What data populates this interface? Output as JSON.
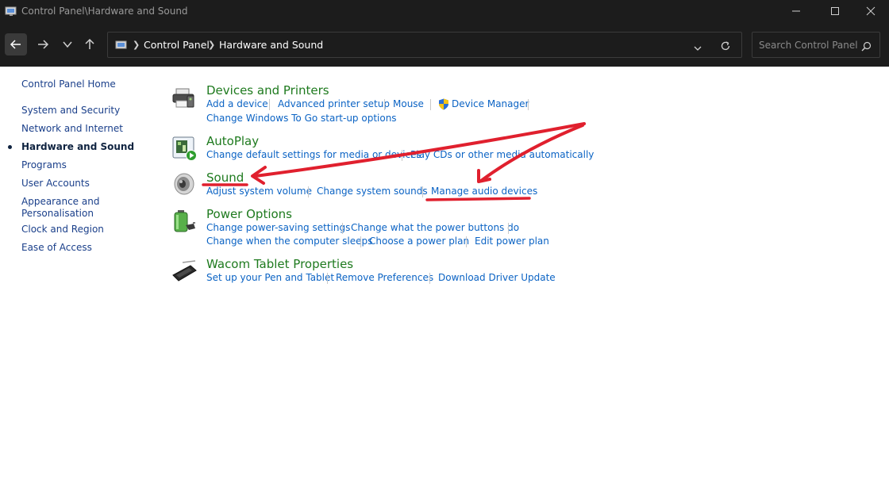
{
  "window": {
    "title": "Control Panel\\Hardware and Sound"
  },
  "address_bar": {
    "crumbs": [
      "Control Panel",
      "Hardware and Sound"
    ],
    "search_placeholder": "Search Control Panel"
  },
  "sidebar": {
    "items": [
      {
        "label": "Control Panel Home"
      },
      {
        "label": "System and Security"
      },
      {
        "label": "Network and Internet"
      },
      {
        "label": "Hardware and Sound",
        "active": true
      },
      {
        "label": "Programs"
      },
      {
        "label": "User Accounts"
      },
      {
        "label": "Appearance and Personalisation"
      },
      {
        "label": "Clock and Region"
      },
      {
        "label": "Ease of Access"
      }
    ],
    "appearance_line1": "Appearance and",
    "appearance_line2": "Personalisation"
  },
  "categories": [
    {
      "title": "Devices and Printers",
      "icon": "printer-icon",
      "links": [
        "Add a device",
        "Advanced printer setup",
        "Mouse",
        "Device Manager",
        "Change Windows To Go start-up options"
      ]
    },
    {
      "title": "AutoPlay",
      "icon": "autoplay-icon",
      "links": [
        "Change default settings for media or devices",
        "Play CDs or other media automatically"
      ]
    },
    {
      "title": "Sound",
      "icon": "speaker-icon",
      "links": [
        "Adjust system volume",
        "Change system sounds",
        "Manage audio devices"
      ]
    },
    {
      "title": "Power Options",
      "icon": "battery-icon",
      "links": [
        "Change power-saving settings",
        "Change what the power buttons do",
        "Change when the computer sleeps",
        "Choose a power plan",
        "Edit power plan"
      ]
    },
    {
      "title": "Wacom Tablet Properties",
      "icon": "tablet-pen-icon",
      "links": [
        "Set up your Pen and Tablet",
        "Remove Preferences",
        "Download Driver Update"
      ]
    }
  ],
  "colors": {
    "chrome": "#1c1c1c",
    "category_title": "#1e7a1e",
    "task_link": "#0b63c4",
    "annotation_red": "#e0202e"
  }
}
